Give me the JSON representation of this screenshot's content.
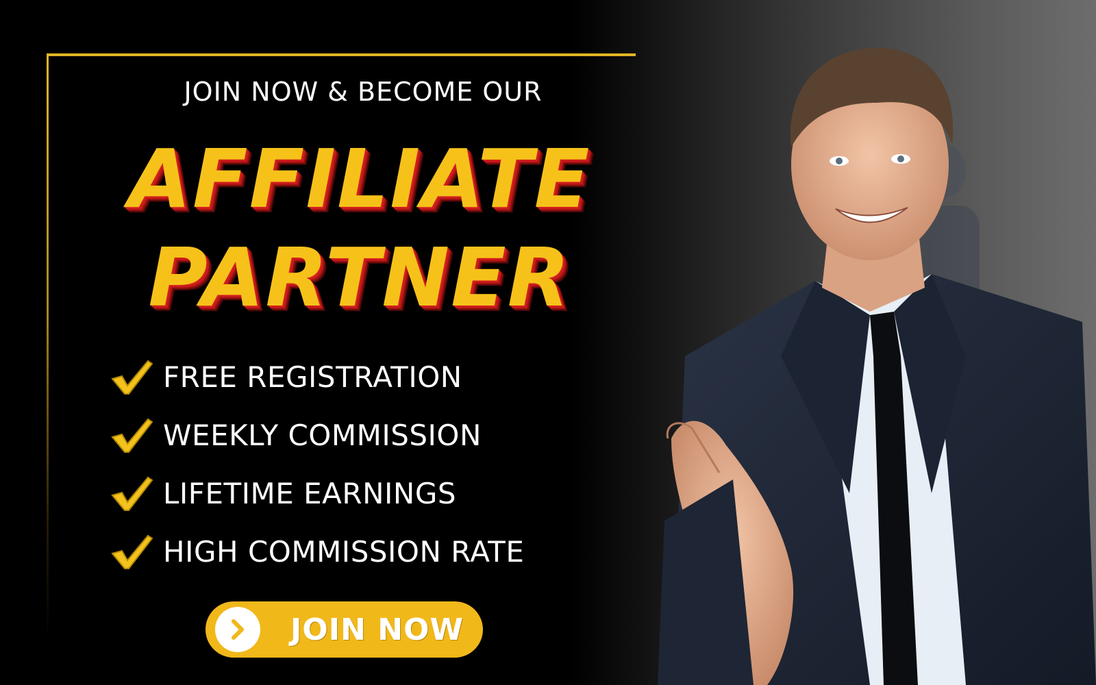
{
  "banner": {
    "eyebrow": "JOIN NOW & BECOME OUR",
    "headline_line1": "AFFILIATE",
    "headline_line2": "PARTNER",
    "benefits": [
      {
        "label": "FREE REGISTRATION",
        "icon": "checkmark-icon"
      },
      {
        "label": "WEEKLY COMMISSION",
        "icon": "checkmark-icon"
      },
      {
        "label": "LIFETIME EARNINGS",
        "icon": "checkmark-icon"
      },
      {
        "label": "HIGH COMMISSION RATE",
        "icon": "checkmark-icon"
      }
    ],
    "cta": {
      "label": "JOIN NOW",
      "icon": "chevron-right-icon"
    },
    "photo": {
      "description": "smiling businessman offering handshake"
    }
  },
  "colors": {
    "background": "#000000",
    "accent_gold": "#f6c21a",
    "headline_shadow_red": "#d51f1f",
    "button_yellow": "#f1b81a",
    "text_white": "#ffffff"
  }
}
